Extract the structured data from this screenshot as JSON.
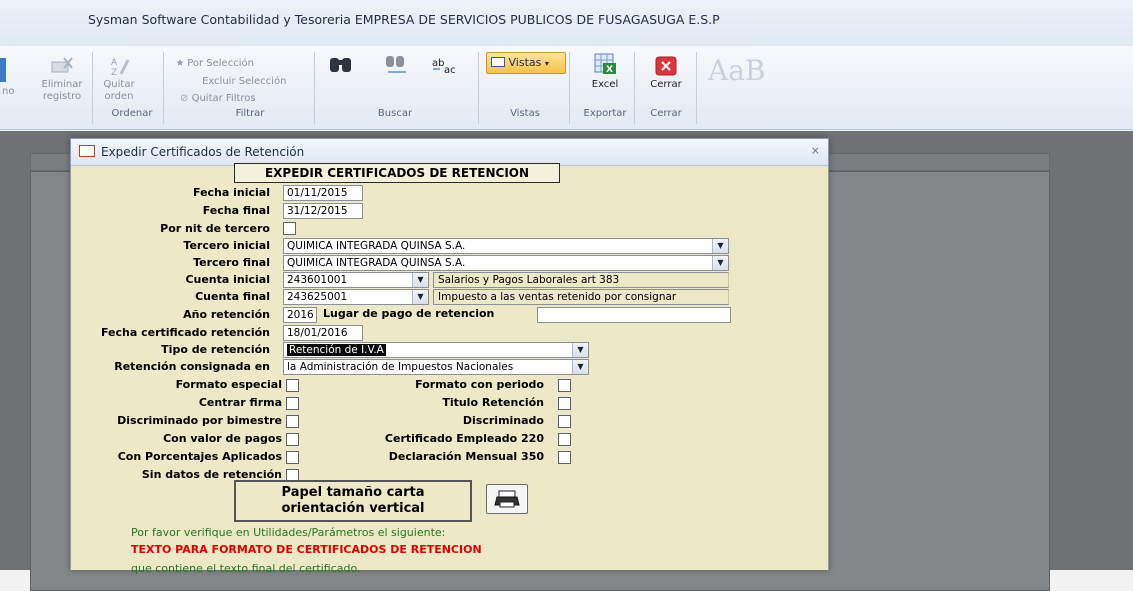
{
  "window": {
    "title": "Sysman Software Contabilidad y Tesoreria EMPRESA DE SERVICIOS PUBLICOS DE FUSAGASUGA E.S.P"
  },
  "ribbon": {
    "cut_label": "no",
    "eliminar_label_1": "Eliminar",
    "eliminar_label_2": "registro",
    "quitar_orden_1": "Quitar",
    "quitar_orden_2": "orden",
    "group_ordenar": "Ordenar",
    "por_seleccion": "Por Selección",
    "excluir_seleccion": "Excluir Selección",
    "quitar_filtros": "Quitar Filtros",
    "group_filtrar": "Filtrar",
    "group_buscar": "Buscar",
    "vistas_label": "Vistas",
    "group_vistas": "Vistas",
    "excel_label": "Excel",
    "group_exportar": "Exportar",
    "cerrar_label": "Cerrar",
    "group_cerrar": "Cerrar",
    "ghost_text": "AaB",
    "accent_color": "#f6c34a"
  },
  "dialog": {
    "title": "Expedir Certificados de Retención",
    "heading": "EXPEDIR CERTIFICADOS  DE RETENCION",
    "fecha_inicial_label": "Fecha inicial",
    "fecha_inicial_value": "01/11/2015",
    "fecha_final_label": "Fecha final",
    "fecha_final_value": "31/12/2015",
    "por_nit_label": "Por nit de tercero",
    "tercero_inicial_label": "Tercero inicial",
    "tercero_inicial_value": "QUIMICA INTEGRADA QUINSA S.A.",
    "tercero_final_label": "Tercero final",
    "tercero_final_value": "QUIMICA INTEGRADA QUINSA S.A.",
    "cuenta_inicial_label": "Cuenta inicial",
    "cuenta_inicial_value": "243601001",
    "cuenta_inicial_desc": "Salarios y Pagos Laborales art 383",
    "cuenta_final_label": "Cuenta final",
    "cuenta_final_value": "243625001",
    "cuenta_final_desc": "Impuesto a las ventas retenido por consignar",
    "anio_label": "Año retención",
    "anio_value": "2016",
    "lugar_label": "Lugar de pago de retencion",
    "lugar_value": "",
    "fecha_cert_label": "Fecha certificado retención",
    "fecha_cert_value": "18/01/2016",
    "tipo_label": "Tipo de retención",
    "tipo_value": "Retención de I.V.A",
    "consignada_label": "Retención consignada en",
    "consignada_value": "la Administración de Impuestos Nacionales",
    "formato_especial_label": "Formato especial",
    "centrar_firma_label": "Centrar firma",
    "discriminado_bimestre_label": "Discriminado por bimestre",
    "con_valor_label": "Con valor de pagos",
    "con_porcentajes_label": "Con Porcentajes Aplicados",
    "sin_datos_label": "Sin datos de retención",
    "formato_periodo_label": "Formato con periodo",
    "titulo_retencion_label": "Titulo Retención",
    "discriminado_label": "Discriminado",
    "cert_empleado_label": "Certificado Empleado 220",
    "declaracion_label": "Declaración Mensual 350",
    "paper_line1": "Papel tamaño carta",
    "paper_line2": "orientación vertical",
    "note_line1": "Por favor verifique en Utilidades/Parámetros el siguiente:",
    "note_line2": "TEXTO PARA FORMATO DE CERTIFICADOS DE RETENCION",
    "note_line3": "que contiene el texto final del certificado.",
    "selection_color": "#0a0a0a",
    "warning_color": "#e00000",
    "note_color": "#1f7a1f"
  }
}
